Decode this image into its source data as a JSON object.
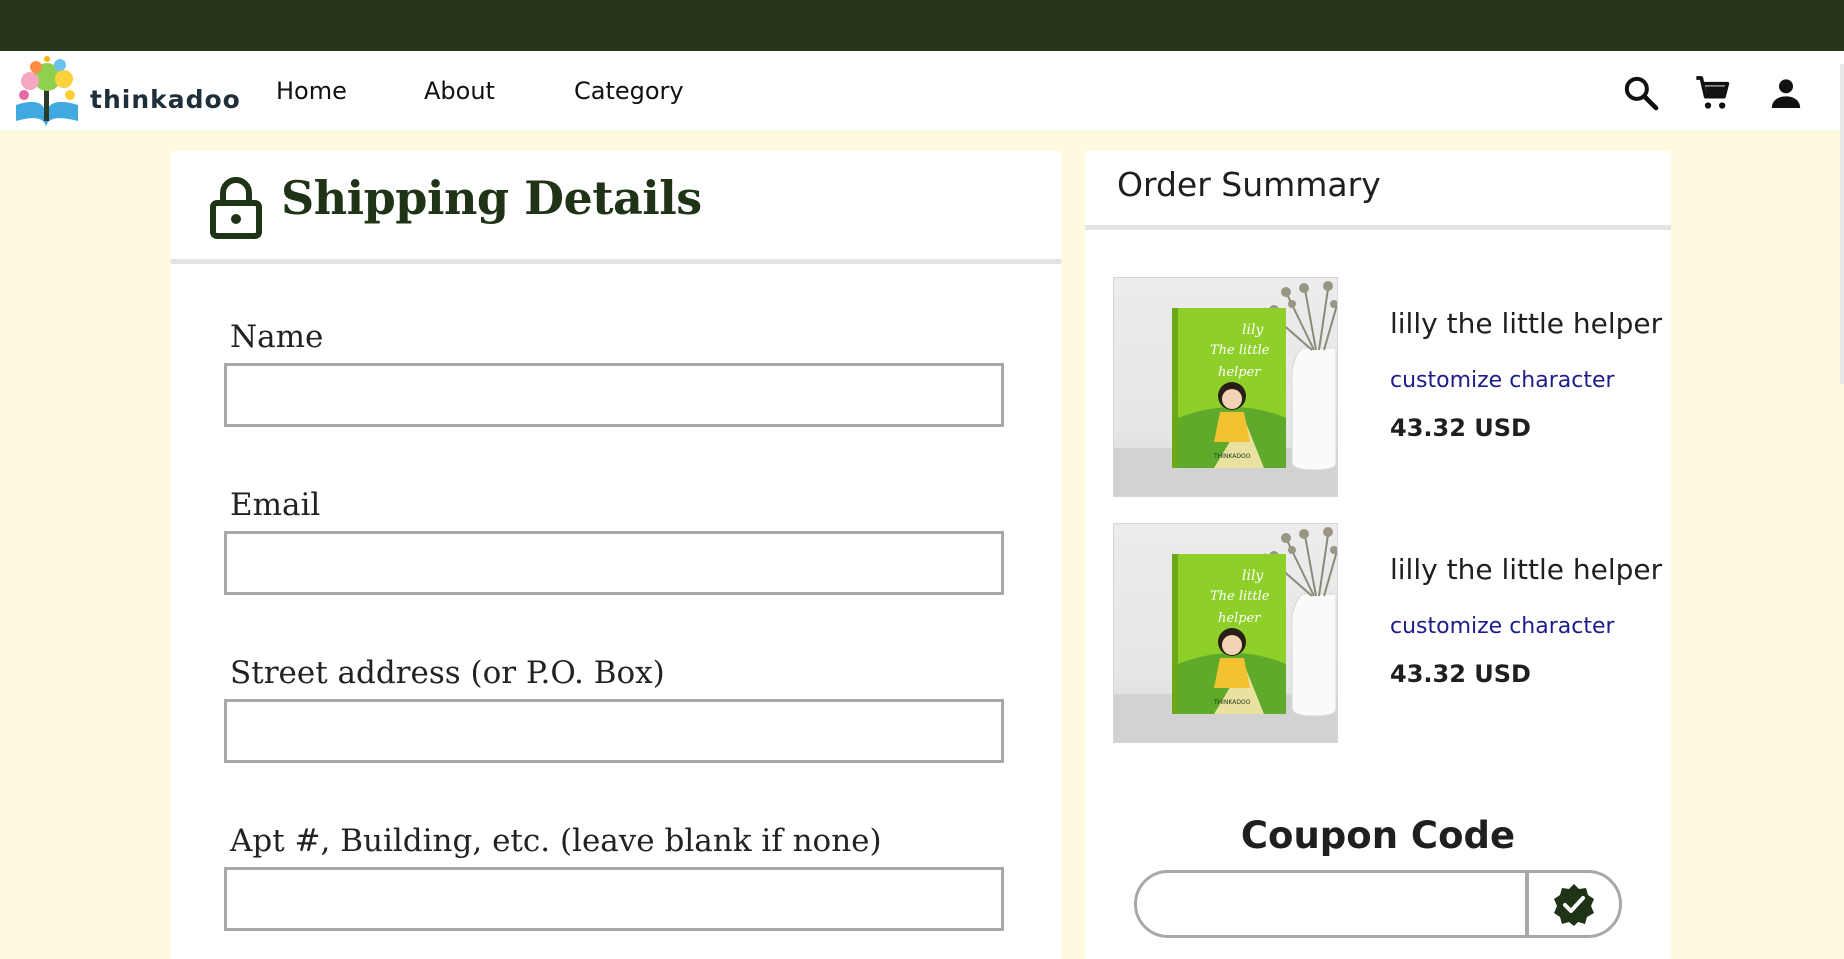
{
  "brand": {
    "name": "thinkadoo"
  },
  "nav": {
    "links": [
      "Home",
      "About",
      "Category"
    ],
    "icons": [
      "search-icon",
      "cart-icon",
      "account-icon"
    ]
  },
  "shipping": {
    "title": "Shipping Details",
    "fields": [
      {
        "label": "Name",
        "value": "",
        "placeholder": ""
      },
      {
        "label": "Email",
        "value": "",
        "placeholder": ""
      },
      {
        "label": "Street address (or P.O. Box)",
        "value": "",
        "placeholder": ""
      },
      {
        "label": "Apt #, Building, etc. (leave blank if none)",
        "value": "",
        "placeholder": ""
      }
    ]
  },
  "summary": {
    "title": "Order Summary",
    "items": [
      {
        "name": "lilly the little helper",
        "customize": "customize character",
        "price": "43.32 USD",
        "cover_text": "lily The little helper",
        "cover_brand": "THINKADOO"
      },
      {
        "name": "lilly the little helper",
        "customize": "customize character",
        "price": "43.32 USD",
        "cover_text": "lily The little helper",
        "cover_brand": "THINKADOO"
      }
    ],
    "coupon": {
      "title": "Coupon Code",
      "value": "",
      "button_icon": "verified-check-icon"
    }
  },
  "colors": {
    "topbar": "#28341a",
    "page_background": "#fdfadf",
    "title_green": "#1f3317",
    "link_blue": "#1d1d8a",
    "cover_green": "#8fcf2a"
  }
}
